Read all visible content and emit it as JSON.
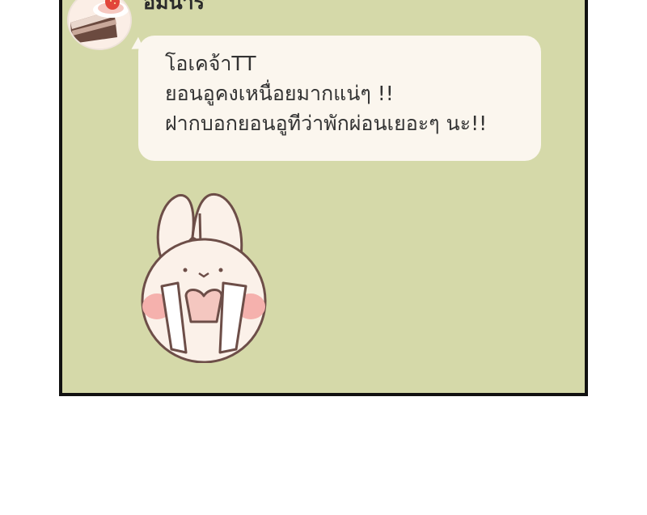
{
  "chat": {
    "sender_name": "อิมนาริ",
    "message_lines": [
      "โอเคจ้าTT",
      "ยอนอูคงเหนื่อยมากแน่ๆ !!",
      "ฝากบอกยอนอูทีว่าพักผ่อนเยอะๆ นะ!!"
    ],
    "avatar_icon": "cake-slice-icon",
    "sticker_icon": "crying-bunny-sticker-icon"
  },
  "colors": {
    "panel_background": "#d5d9a9",
    "bubble_background": "#fbf6ee",
    "panel_border": "#111111",
    "text": "#333333"
  }
}
